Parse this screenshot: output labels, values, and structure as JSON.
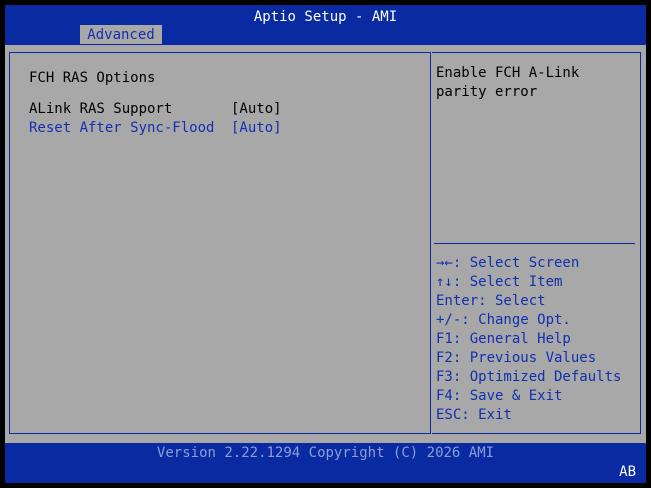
{
  "header": {
    "title": "Aptio Setup - AMI",
    "tabs": [
      {
        "label": "Advanced",
        "active": true
      }
    ]
  },
  "main": {
    "section_title": "FCH RAS Options",
    "settings": [
      {
        "label": "ALink RAS Support",
        "value": "[Auto]",
        "highlighted": false
      },
      {
        "label": "Reset After Sync-Flood",
        "value": "[Auto]",
        "highlighted": true
      }
    ]
  },
  "help": {
    "text": "Enable FCH A-Link\nparity error"
  },
  "keys": [
    {
      "text": "→←: Select Screen"
    },
    {
      "text": "↑↓: Select Item"
    },
    {
      "text": "Enter: Select"
    },
    {
      "text": "+/-: Change Opt."
    },
    {
      "text": "F1: General Help"
    },
    {
      "text": "F2: Previous Values"
    },
    {
      "text": "F3: Optimized Defaults"
    },
    {
      "text": "F4: Save & Exit"
    },
    {
      "text": "ESC: Exit"
    }
  ],
  "footer": {
    "version": "Version 2.22.1294 Copyright (C) 2026 AMI",
    "badge": "AB"
  },
  "colors": {
    "frame_blue": "#0a2aa2",
    "panel_gray": "#a8a8a8",
    "text_blue": "#1030b0",
    "text_black": "#000000",
    "text_white": "#ffffff"
  }
}
